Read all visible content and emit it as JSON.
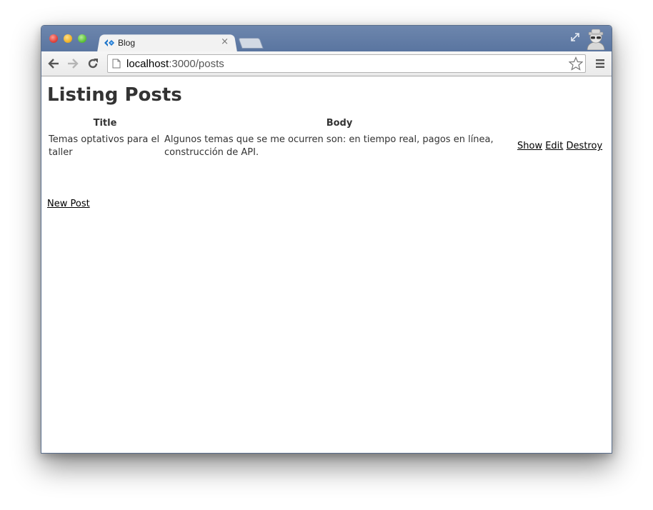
{
  "browser": {
    "tab": {
      "title": "Blog",
      "close_label": "×"
    },
    "address": {
      "host": "localhost",
      "rest": ":3000/posts"
    },
    "colors": {
      "titlebar": "#5a75a0",
      "tab": "#f2f2f2"
    }
  },
  "page": {
    "heading": "Listing Posts",
    "table": {
      "headers": [
        "Title",
        "Body"
      ],
      "rows": [
        {
          "title": "Temas optativos para el taller",
          "body": "Algunos temas que se me ocurren son: en tiempo real, pagos en línea, construcción de API.",
          "actions": {
            "show": "Show",
            "edit": "Edit",
            "destroy": "Destroy"
          }
        }
      ]
    },
    "new_post_link": "New Post"
  }
}
